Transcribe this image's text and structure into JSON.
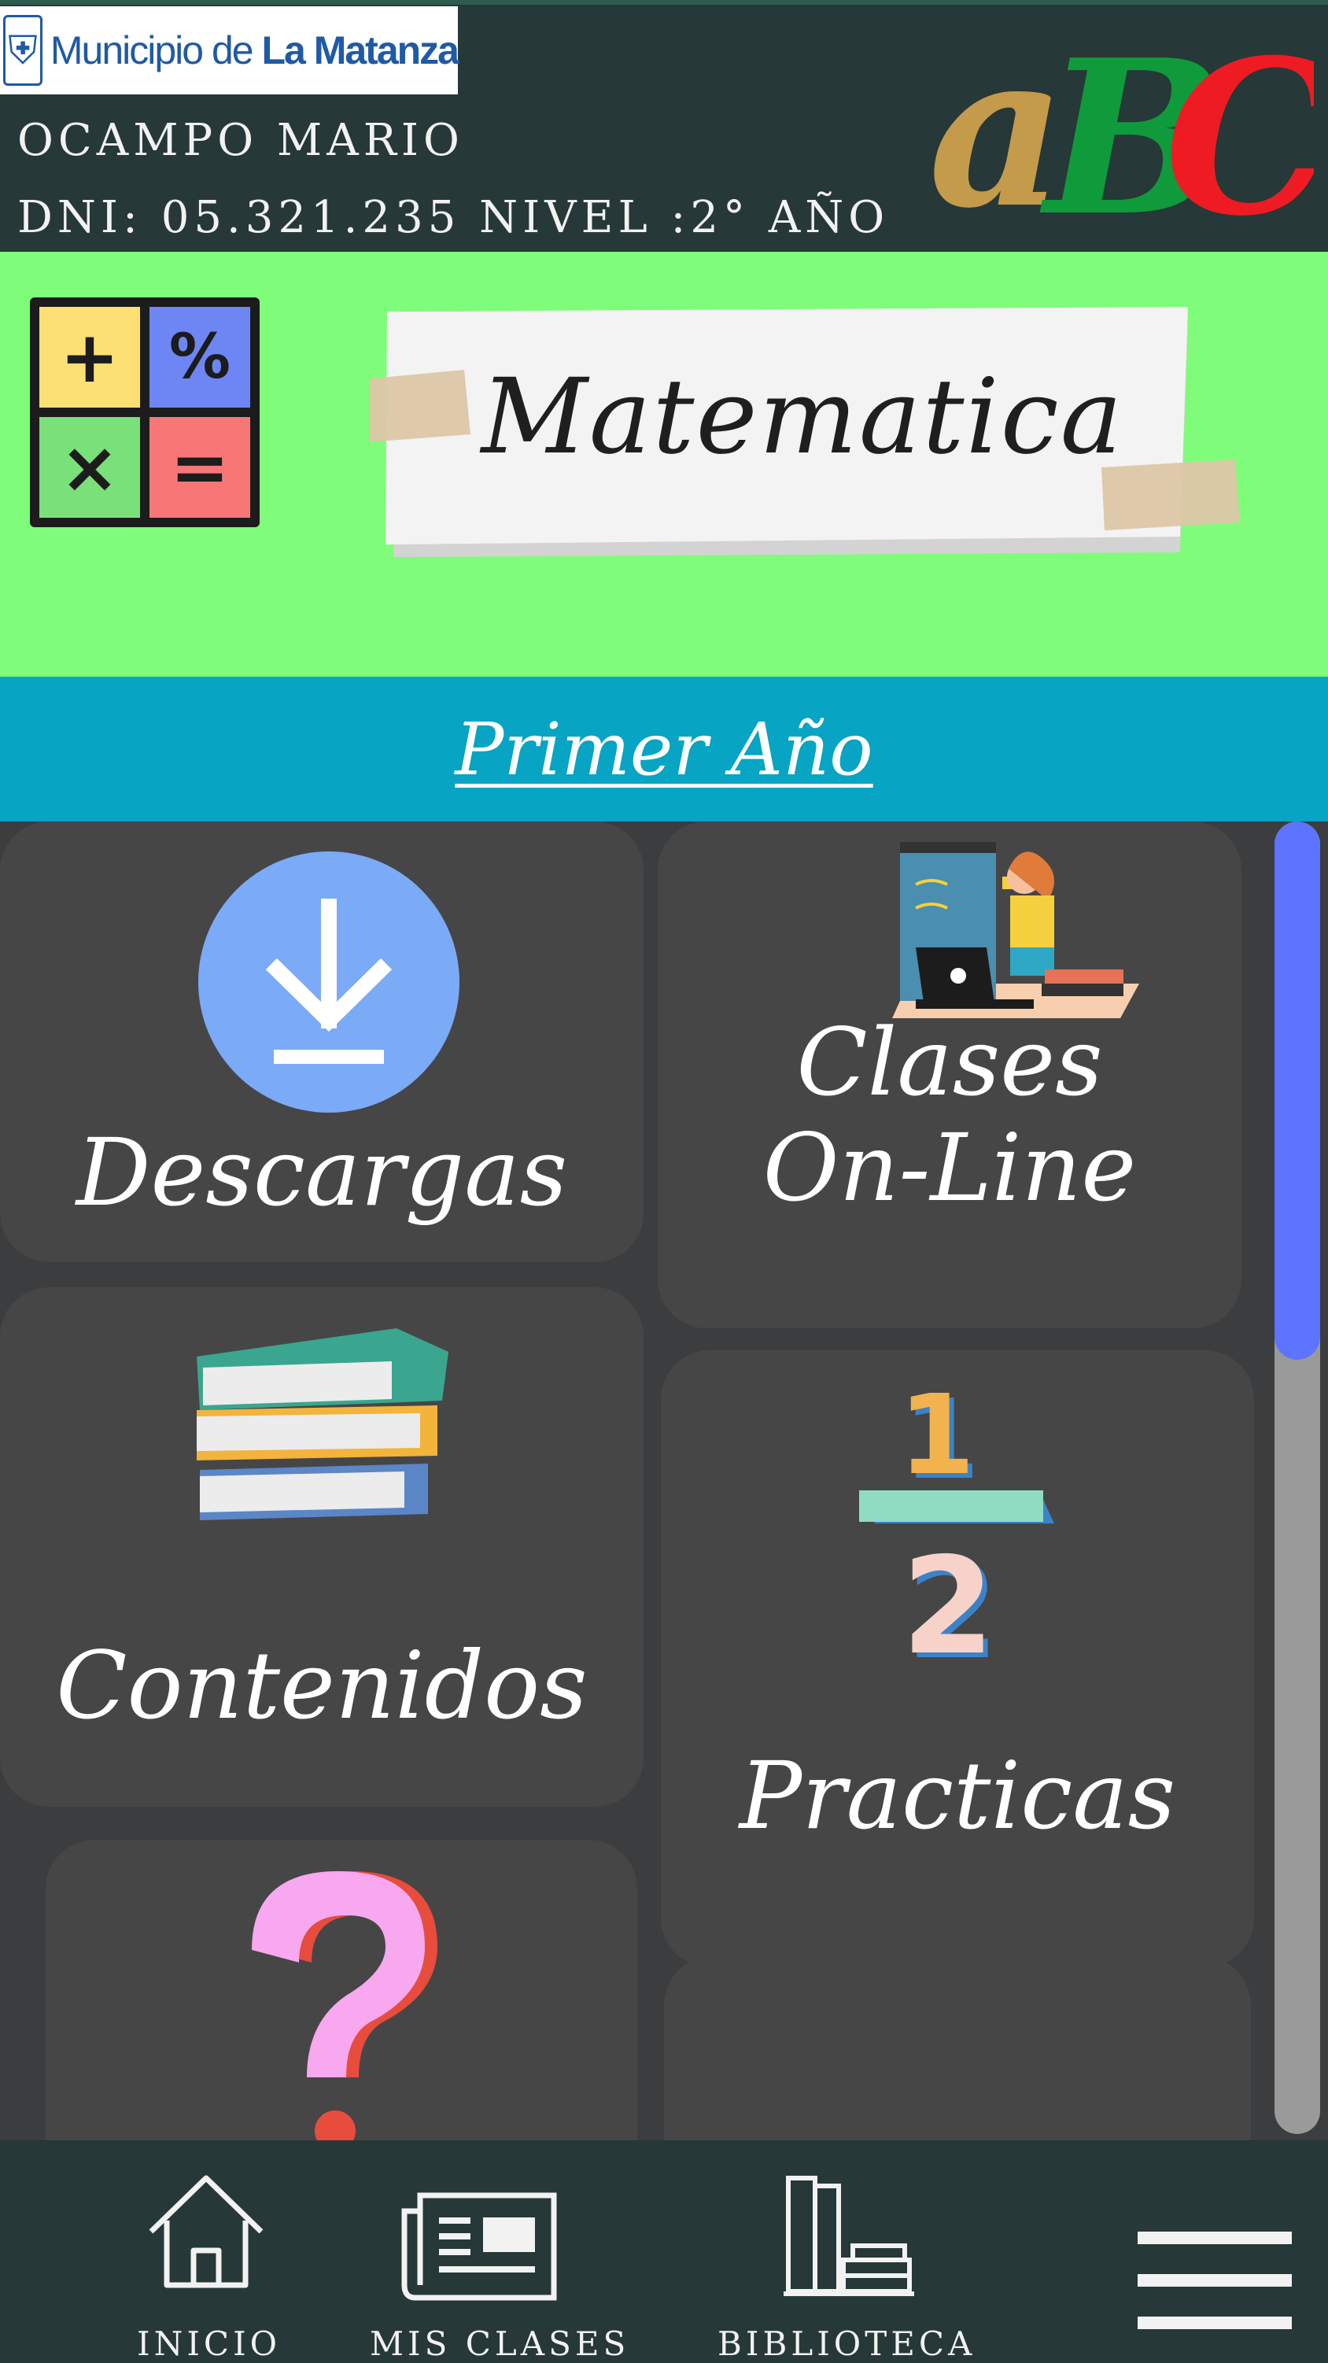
{
  "header": {
    "municipality_logo_text": "Municipio de La Matanza",
    "user_name": "OCAMPO MARIO",
    "user_info": "DNI: 05.321.235 NIVEL :2° AÑO",
    "brand_logo_text": "ABC",
    "colors": {
      "background": "#263837",
      "logo_blue": "#1f5aa6",
      "abc_gold": "#c49a4b",
      "abc_green": "#0f9a3c",
      "abc_red": "#ee1c22"
    }
  },
  "banner": {
    "subject_title": "Matematica",
    "calculator_icon": "calculator-icon",
    "background_color": "#7ffc7a"
  },
  "year_strip": {
    "label": "Primer Año",
    "background_color": "#07a4c3"
  },
  "cards": {
    "downloads": {
      "label": "Descargas",
      "icon": "download-icon"
    },
    "online_classes": {
      "label_line1": "Clases",
      "label_line2": "On-Line",
      "icon": "teacher-icon"
    },
    "contents": {
      "label": "Contenidos",
      "icon": "books-icon"
    },
    "practices": {
      "label": "Practicas",
      "icon": "fraction-icon"
    },
    "help": {
      "icon": "question-mark-icon"
    }
  },
  "scrollbar": {
    "thumb_color": "#5c74ff",
    "track_color": "#9a9a9a"
  },
  "bottom_nav": {
    "items": [
      {
        "label": "INICIO",
        "icon": "home-icon"
      },
      {
        "label": "MIS CLASES",
        "icon": "newspaper-icon"
      },
      {
        "label": "BIBLIOTECA",
        "icon": "library-icon"
      },
      {
        "label": "",
        "icon": "hamburger-menu-icon"
      }
    ]
  }
}
